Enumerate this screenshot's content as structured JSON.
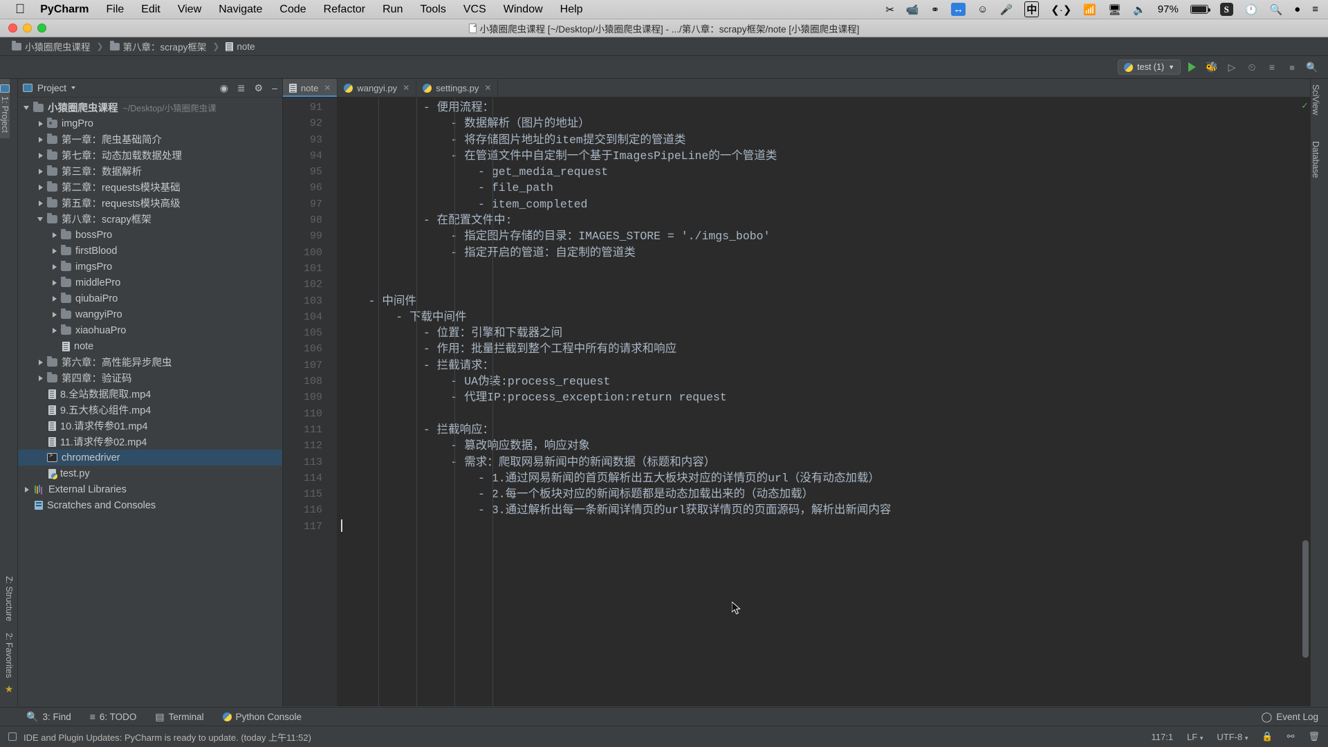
{
  "macbar": {
    "apple_icon": "apple-icon",
    "app_name": "PyCharm",
    "menus": [
      "File",
      "Edit",
      "View",
      "Navigate",
      "Code",
      "Refactor",
      "Run",
      "Tools",
      "VCS",
      "Window",
      "Help"
    ],
    "status_icons": [
      "scissors-icon",
      "screen-record-icon",
      "creative-cloud-icon",
      "teamviewer-icon",
      "emoji-icon",
      "microphone-icon",
      "input-source-chinese-icon",
      "code-brackets-icon",
      "wifi-icon",
      "airplay-icon",
      "volume-icon"
    ],
    "battery_percent": "97%",
    "battery_icon": "battery-icon",
    "snipaste_icon": "snipaste-icon",
    "timemachine_icon": "time-machine-icon",
    "spotlight_icon": "search-icon",
    "siri_icon": "siri-icon",
    "controlcenter_icon": "list-icon"
  },
  "window": {
    "title": "小猿圈爬虫课程 [~/Desktop/小猿圈爬虫课程] - .../第八章：scrapy框架/note [小猿圈爬虫课程]",
    "doc_icon": "document-icon"
  },
  "breadcrumbs": [
    {
      "label": "小猿圈爬虫课程",
      "icon": "folder-icon"
    },
    {
      "label": "第八章：scrapy框架",
      "icon": "folder-icon"
    },
    {
      "label": "note",
      "icon": "note-file-icon"
    }
  ],
  "toolbar": {
    "run_config": "test (1)",
    "run_config_icon": "python-icon",
    "dropdown_icon": "chevron-down-icon",
    "buttons": [
      "run-icon",
      "debug-icon",
      "coverage-icon",
      "profile-icon",
      "attach-icon",
      "stop-icon",
      "search-everywhere-icon"
    ]
  },
  "left_rail": {
    "top_tab": "1: Project",
    "bottom_tabs": [
      "2: Favorites",
      "Z: Structure"
    ],
    "star_icon": "star-icon"
  },
  "right_rail": {
    "tabs": [
      "SciView",
      "Database"
    ]
  },
  "project_panel": {
    "title": "Project",
    "title_icon": "project-icon",
    "dropdown_icon": "chevron-down-icon",
    "actions": [
      "target-icon",
      "collapse-all-icon",
      "settings-gear-icon",
      "hide-icon"
    ],
    "tree": [
      {
        "label": "小猿圈爬虫课程",
        "path_hint": "~/Desktop/小猿圈爬虫课",
        "depth": 0,
        "arrow": "down",
        "icon": "folder-icon",
        "bold": true
      },
      {
        "label": "imgPro",
        "depth": 1,
        "arrow": "right",
        "icon": "folder-dot-icon"
      },
      {
        "label": "第一章：爬虫基础简介",
        "depth": 1,
        "arrow": "right",
        "icon": "folder-icon"
      },
      {
        "label": "第七章：动态加载数据处理",
        "depth": 1,
        "arrow": "right",
        "icon": "folder-icon"
      },
      {
        "label": "第三章：数据解析",
        "depth": 1,
        "arrow": "right",
        "icon": "folder-icon"
      },
      {
        "label": "第二章：requests模块基础",
        "depth": 1,
        "arrow": "right",
        "icon": "folder-icon"
      },
      {
        "label": "第五章：requests模块高级",
        "depth": 1,
        "arrow": "right",
        "icon": "folder-icon"
      },
      {
        "label": "第八章：scrapy框架",
        "depth": 1,
        "arrow": "down",
        "icon": "folder-icon"
      },
      {
        "label": "bossPro",
        "depth": 2,
        "arrow": "right",
        "icon": "folder-icon"
      },
      {
        "label": "firstBlood",
        "depth": 2,
        "arrow": "right",
        "icon": "folder-icon"
      },
      {
        "label": "imgsPro",
        "depth": 2,
        "arrow": "right",
        "icon": "folder-icon"
      },
      {
        "label": "middlePro",
        "depth": 2,
        "arrow": "right",
        "icon": "folder-icon"
      },
      {
        "label": "qiubaiPro",
        "depth": 2,
        "arrow": "right",
        "icon": "folder-icon"
      },
      {
        "label": "wangyiPro",
        "depth": 2,
        "arrow": "right",
        "icon": "folder-icon"
      },
      {
        "label": "xiaohuaPro",
        "depth": 2,
        "arrow": "right",
        "icon": "folder-icon"
      },
      {
        "label": "note",
        "depth": 2,
        "arrow": "none",
        "icon": "note-file-icon"
      },
      {
        "label": "第六章：高性能异步爬虫",
        "depth": 1,
        "arrow": "right",
        "icon": "folder-icon"
      },
      {
        "label": "第四章：验证码",
        "depth": 1,
        "arrow": "right",
        "icon": "folder-icon"
      },
      {
        "label": "8.全站数据爬取.mp4",
        "depth": 1,
        "arrow": "none",
        "icon": "file-icon"
      },
      {
        "label": "9.五大核心组件.mp4",
        "depth": 1,
        "arrow": "none",
        "icon": "file-icon"
      },
      {
        "label": "10.请求传参01.mp4",
        "depth": 1,
        "arrow": "none",
        "icon": "file-icon"
      },
      {
        "label": "11.请求传参02.mp4",
        "depth": 1,
        "arrow": "none",
        "icon": "file-icon"
      },
      {
        "label": "chromedriver",
        "depth": 1,
        "arrow": "none",
        "icon": "executable-icon",
        "selected": true
      },
      {
        "label": "test.py",
        "depth": 1,
        "arrow": "none",
        "icon": "python-file-icon"
      },
      {
        "label": "External Libraries",
        "depth": 0,
        "arrow": "right",
        "icon": "library-icon"
      },
      {
        "label": "Scratches and Consoles",
        "depth": 0,
        "arrow": "none",
        "icon": "scratch-icon"
      }
    ]
  },
  "editor": {
    "tabs": [
      {
        "label": "note",
        "icon": "note-file-icon",
        "active": true,
        "close_icon": "close-icon"
      },
      {
        "label": "wangyi.py",
        "icon": "python-file-icon",
        "active": false,
        "close_icon": "close-icon"
      },
      {
        "label": "settings.py",
        "icon": "python-file-icon",
        "active": false,
        "close_icon": "close-icon"
      }
    ],
    "first_line_number": 91,
    "lines": [
      {
        "n": 91,
        "text": "            - 便用流程："
      },
      {
        "n": 92,
        "text": "                - 数据解析（图片的地址）"
      },
      {
        "n": 93,
        "text": "                - 将存储图片地址的item提交到制定的管道类"
      },
      {
        "n": 94,
        "text": "                - 在管道文件中自定制一个基于ImagesPipeLine的一个管道类"
      },
      {
        "n": 95,
        "text": "                    - get_media_request"
      },
      {
        "n": 96,
        "text": "                    - file_path"
      },
      {
        "n": 97,
        "text": "                    - item_completed"
      },
      {
        "n": 98,
        "text": "            - 在配置文件中:"
      },
      {
        "n": 99,
        "text": "                - 指定图片存储的目录：IMAGES_STORE = './imgs_bobo'"
      },
      {
        "n": 100,
        "text": "                - 指定开启的管道：自定制的管道类"
      },
      {
        "n": 101,
        "text": ""
      },
      {
        "n": 102,
        "text": ""
      },
      {
        "n": 103,
        "text": "    - 中间件"
      },
      {
        "n": 104,
        "text": "        - 下载中间件"
      },
      {
        "n": 105,
        "text": "            - 位置：引擎和下载器之间"
      },
      {
        "n": 106,
        "text": "            - 作用：批量拦截到整个工程中所有的请求和响应"
      },
      {
        "n": 107,
        "text": "            - 拦截请求："
      },
      {
        "n": 108,
        "text": "                - UA伪装:process_request"
      },
      {
        "n": 109,
        "text": "                - 代理IP:process_exception:return request"
      },
      {
        "n": 110,
        "text": ""
      },
      {
        "n": 111,
        "text": "            - 拦截响应："
      },
      {
        "n": 112,
        "text": "                - 篡改响应数据，响应对象"
      },
      {
        "n": 113,
        "text": "                - 需求：爬取网易新闻中的新闻数据（标题和内容）"
      },
      {
        "n": 114,
        "text": "                    - 1.通过网易新闻的首页解析出五大板块对应的详情页的url（没有动态加载）"
      },
      {
        "n": 115,
        "text": "                    - 2.每一个板块对应的新闻标题都是动态加载出来的（动态加载）"
      },
      {
        "n": 116,
        "text": "                    - 3.通过解析出每一条新闻详情页的url获取详情页的页面源码，解析出新闻内容"
      },
      {
        "n": 117,
        "text": ""
      }
    ],
    "caret_line": 117,
    "inspection_icon": "inspection-ok-icon"
  },
  "bottom_bar": {
    "items": [
      {
        "label": "3: Find",
        "icon": "search-icon",
        "accel": "3"
      },
      {
        "label": "6: TODO",
        "icon": "todo-icon",
        "accel": "6"
      },
      {
        "label": "Terminal",
        "icon": "terminal-icon"
      },
      {
        "label": "Python Console",
        "icon": "python-icon"
      }
    ],
    "event_log": "Event Log",
    "event_log_icon": "event-log-icon"
  },
  "status_bar": {
    "message": "IDE and Plugin Updates: PyCharm is ready to update. (today 上午11:52)",
    "left_icon": "balloon-icon",
    "caret_position": "117:1",
    "line_separator": "LF",
    "encoding": "UTF-8",
    "lock_icon": "lock-icon",
    "branch_icon": "git-branch-icon",
    "trash_icon": "trash-icon",
    "separator_dropdown_icon": "chevron-down-icon"
  },
  "colors": {
    "accent": "#4a88c7",
    "editor_bg": "#2b2b2b",
    "panel_bg": "#3c3f41",
    "gutter_bg": "#313335",
    "text": "#a9b7c6",
    "selection": "#2f4d66"
  }
}
